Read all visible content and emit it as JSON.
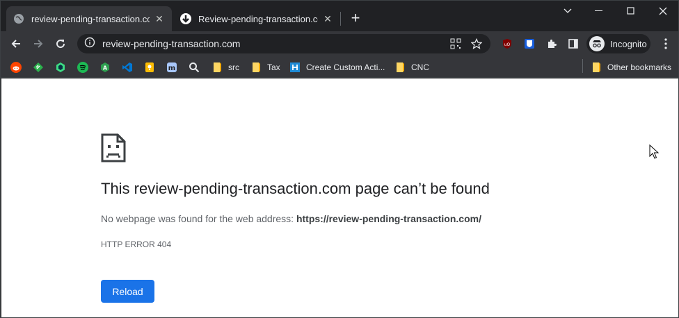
{
  "browser": {
    "tabs": [
      {
        "title": "review-pending-transaction.com",
        "favicon": "globe-icon",
        "active": true
      },
      {
        "title": "Review-pending-transaction.com",
        "favicon": "download-arrow-icon",
        "active": false
      }
    ],
    "new_tab_label": "+",
    "address_bar": {
      "url": "review-pending-transaction.com"
    },
    "profile_label": "Incognito",
    "bookmarks": [
      {
        "label": "",
        "icon": "reddit-icon"
      },
      {
        "label": "",
        "icon": "feedly-icon"
      },
      {
        "label": "",
        "icon": "android-studio-icon"
      },
      {
        "label": "",
        "icon": "spotify-icon"
      },
      {
        "label": "",
        "icon": "android-icon"
      },
      {
        "label": "",
        "icon": "vscode-icon"
      },
      {
        "label": "",
        "icon": "keep-icon"
      },
      {
        "label": "",
        "icon": "m-icon"
      },
      {
        "label": "",
        "icon": "search-icon"
      },
      {
        "label": "src",
        "icon": "folder-icon"
      },
      {
        "label": "Tax",
        "icon": "folder-icon"
      },
      {
        "label": "Create Custom Acti...",
        "icon": "custom-action-icon"
      },
      {
        "label": "CNC",
        "icon": "folder-icon"
      }
    ],
    "other_bookmarks_label": "Other bookmarks"
  },
  "page": {
    "title": "This review-pending-transaction.com page can’t be found",
    "description_prefix": "No webpage was found for the web address: ",
    "description_url": "https://review-pending-transaction.com/",
    "error_code": "HTTP ERROR 404",
    "reload_label": "Reload"
  },
  "colors": {
    "tab_bg": "#35363a",
    "titlebar_bg": "#202124",
    "button_blue": "#1a73e8"
  }
}
